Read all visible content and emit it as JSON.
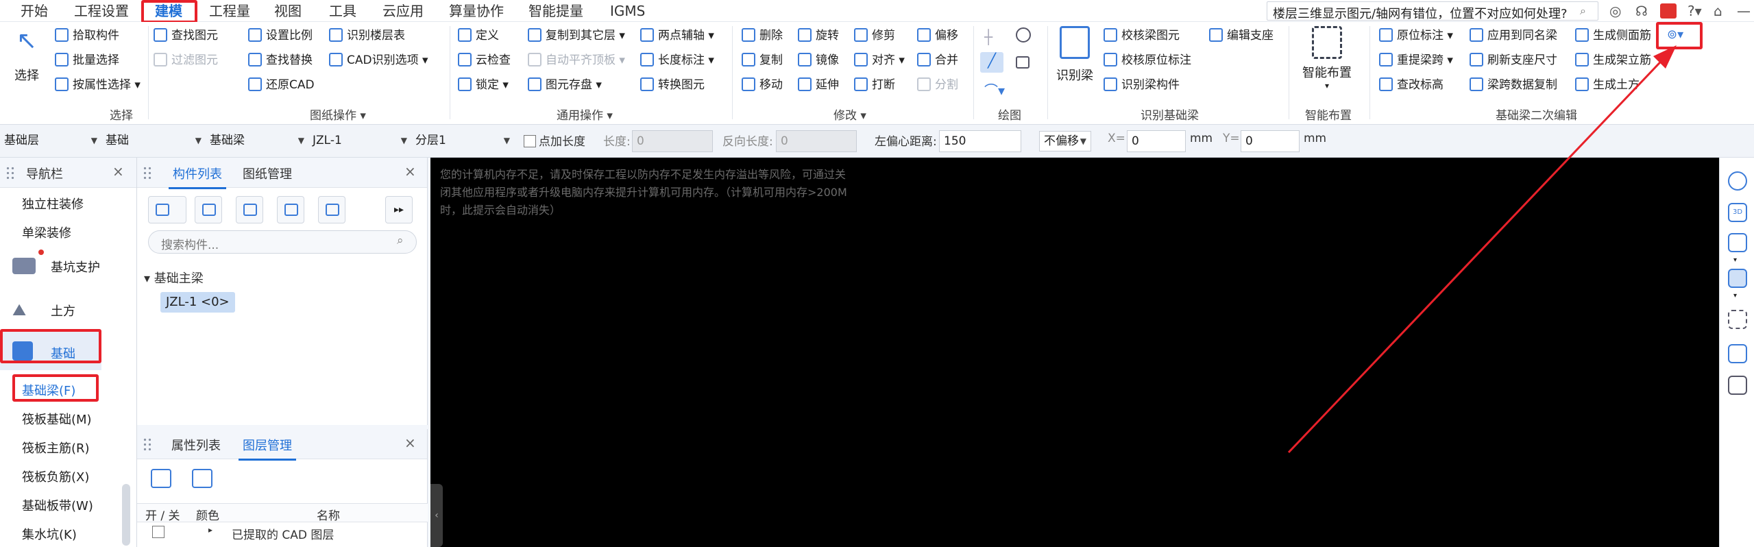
{
  "menubar": {
    "items": [
      "开始",
      "工程设置",
      "建模",
      "工程量",
      "视图",
      "工具",
      "云应用",
      "算量协作",
      "智能提量",
      "IGMS"
    ],
    "active": "建模",
    "search_text": "楼层三维显示图元/轴网有错位，位置不对应如何处理?",
    "icons": [
      "search-icon",
      "user-icon",
      "headset-icon",
      "red-notice-icon",
      "help-icon",
      "skin-icon",
      "minimize-icon"
    ],
    "help_label": "?"
  },
  "ribbon": {
    "select": {
      "big": "选择",
      "items": [
        "拾取构件",
        "批量选择",
        "按属性选择"
      ],
      "group": "选择"
    },
    "drawing_ops": {
      "items": [
        "查找图元",
        "过滤图元",
        "设置比例",
        "查找替换",
        "还原CAD",
        "识别楼层表",
        "CAD识别选项"
      ],
      "group": "图纸操作"
    },
    "common_ops": {
      "items": [
        "定义",
        "云检查",
        "锁定",
        "复制到其它层",
        "自动平齐顶板",
        "图元存盘",
        "两点辅轴",
        "长度标注",
        "转换图元"
      ],
      "group": "通用操作"
    },
    "modify": {
      "items": [
        "删除",
        "旋转",
        "修剪",
        "偏移",
        "复制",
        "镜像",
        "对齐",
        "合并",
        "移动",
        "延伸",
        "打断",
        "分割"
      ],
      "group": "修改"
    },
    "draw": {
      "group": "绘图"
    },
    "identify_beam": {
      "big": "识别梁",
      "items": [
        "校核梁图元",
        "编辑支座",
        "校核原位标注",
        "识别梁构件"
      ],
      "group": "识别基础梁"
    },
    "smart": {
      "big": "智能布置",
      "group": "智能布置"
    },
    "secondary_edit": {
      "items": [
        "原位标注",
        "应用到同名梁",
        "生成侧面筋",
        "重提梁跨",
        "刷新支座尺寸",
        "生成架立筋",
        "查改标高",
        "梁跨数据复制",
        "生成土方"
      ],
      "group": "基础梁二次编辑"
    }
  },
  "propbar": {
    "floor": "基础层",
    "category": "基础",
    "type": "基础梁",
    "component": "JZL-1",
    "layer": "分层1",
    "point_length_label": "点加长度",
    "length_label": "长度:",
    "length_value": "0",
    "reverse_length_label": "反向长度:",
    "reverse_length_value": "0",
    "left_offset_label": "左偏心距离:",
    "left_offset_value": "150",
    "offset_mode": "不偏移",
    "x_label": "X=",
    "x_value": "0",
    "y_label": "Y=",
    "y_value": "0",
    "unit": "mm"
  },
  "nav": {
    "title": "导航栏",
    "items": [
      "独立柱装修",
      "单梁装修",
      "基坑支护",
      "土方",
      "基础",
      "基础梁(F)",
      "筏板基础(M)",
      "筏板主筋(R)",
      "筏板负筋(X)",
      "基础板带(W)",
      "集水坑(K)"
    ]
  },
  "component_panel": {
    "tabs": [
      "构件列表",
      "图纸管理"
    ],
    "search_placeholder": "搜索构件...",
    "tree_group": "基础主梁",
    "tree_item": "JZL-1 <0>"
  },
  "layer_panel": {
    "tabs": [
      "属性列表",
      "图层管理"
    ],
    "columns": [
      "开 / 关",
      "颜色",
      "名称"
    ],
    "rows": [
      {
        "name": "已提取的 CAD 图层"
      }
    ]
  },
  "canvas": {
    "message": "您的计算机内存不足，请及时保存工程以防内存不足发生内存溢出等风险，可通过关闭其他应用程序或者升级电脑内存来提升计算机可用内存。（计算机可用内存>200M时，此提示会自动消失）"
  },
  "colors": {
    "accent": "#1f6fd6",
    "highlight": "#e8212a",
    "canvas": "#000000"
  }
}
